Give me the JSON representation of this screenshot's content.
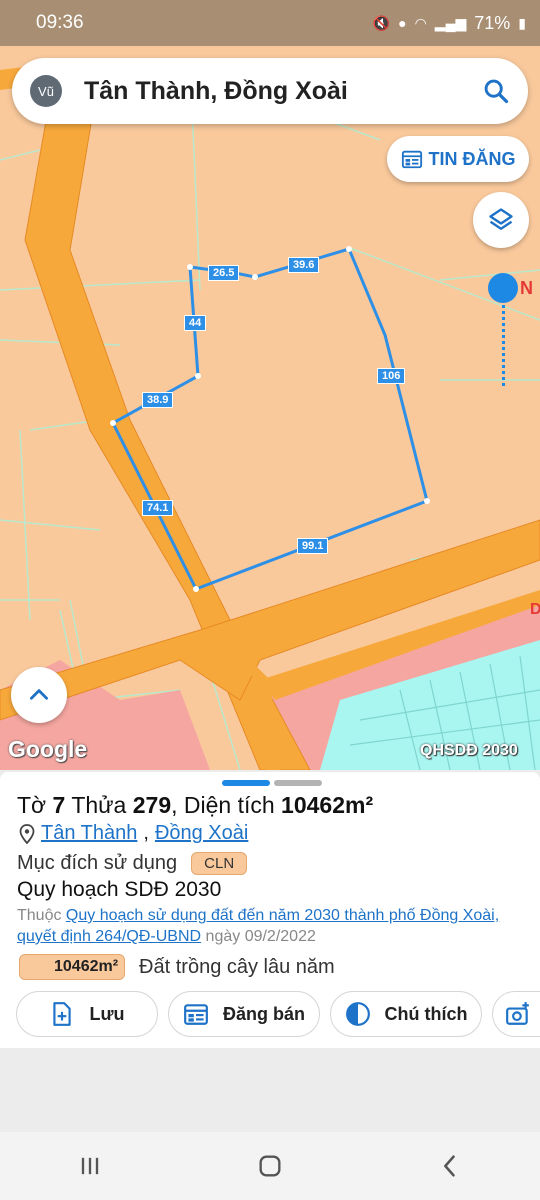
{
  "status_bar": {
    "time": "09:36",
    "battery": "71%"
  },
  "search": {
    "avatar": "Vũ",
    "title": "Tân Thành, Đồng Xoài",
    "icon": "search-icon"
  },
  "map": {
    "post_button": "TIN ĐĂNG",
    "compass_label": "N",
    "attribution": "Google",
    "layer_label": "QHSDĐ 2030",
    "edge_labels": [
      "26.5",
      "39.6",
      "44",
      "106",
      "38.9",
      "74.1",
      "99.1"
    ],
    "colors": {
      "cln_land": "#f9c99c",
      "road": "#f7a83b",
      "parcel_line": "#2e8fe6",
      "residential": "#f5a6a0",
      "water": "#a9f5f0"
    }
  },
  "sheet": {
    "title_prefix": "Tờ",
    "sheet_no": "7",
    "parcel_label": "Thửa",
    "parcel_no": "279",
    "area_label": ", Diện tích",
    "area_value": "10462m²",
    "ward": "Tân Thành",
    "city": "Đồng Xoài",
    "purpose_label": "Mục đích sử dụng",
    "purpose_code": "CLN",
    "plan_title": "Quy hoạch SDĐ 2030",
    "belongs_prefix": "Thuộc",
    "belongs_link": "Quy hoạch sử dụng đất đến năm 2030 thành phố Đồng Xoài, quyết định 264/QĐ-UBND",
    "belongs_date": "ngày 09/2/2022",
    "area_badge": "10462m²",
    "area_desc": "Đất trồng cây lâu năm",
    "actions": [
      {
        "label": "Lưu",
        "icon": "file-add-icon"
      },
      {
        "label": "Đăng bán",
        "icon": "calendar-icon"
      },
      {
        "label": "Chú thích",
        "icon": "contrast-icon"
      },
      {
        "label": "",
        "icon": "add-photo-icon"
      }
    ]
  }
}
